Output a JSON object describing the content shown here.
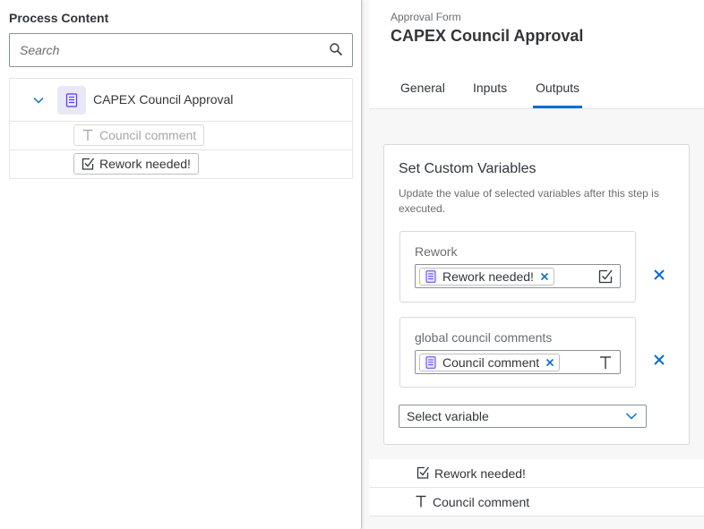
{
  "popup": {
    "title": "Process Content",
    "search_placeholder": "Search",
    "tree": {
      "root_label": "CAPEX Council Approval",
      "root_icon": "form-icon",
      "children": [
        {
          "label": "Council comment",
          "icon": "text-type-icon",
          "state": "disabled"
        },
        {
          "label": "Rework needed!",
          "icon": "checkbox-type-icon",
          "state": "enabled"
        }
      ]
    }
  },
  "panel": {
    "eyebrow": "Approval Form",
    "title": "CAPEX Council Approval",
    "tabs": [
      {
        "label": "General",
        "selected": false
      },
      {
        "label": "Inputs",
        "selected": false
      },
      {
        "label": "Outputs",
        "selected": true
      }
    ],
    "custom_variables": {
      "title": "Set Custom Variables",
      "description": "Update the value of selected variables after this step is executed.",
      "variables": [
        {
          "name": "Rework",
          "token": "Rework needed!",
          "type_icon": "checkbox-type-icon"
        },
        {
          "name": "global council comments",
          "token": "Council comment",
          "type_icon": "text-type-icon"
        }
      ],
      "select_label": "Select variable"
    },
    "list": [
      {
        "label": "Rework needed!",
        "icon": "checkbox-type-icon"
      },
      {
        "label": "Council comment",
        "icon": "text-type-icon"
      }
    ]
  },
  "colors": {
    "accent": "#0a6ed1",
    "text": "#32363a",
    "muted": "#6a6d70",
    "form_icon_bg": "#e8e8f7",
    "form_icon": "#5d36ff",
    "border": "#89919a"
  }
}
